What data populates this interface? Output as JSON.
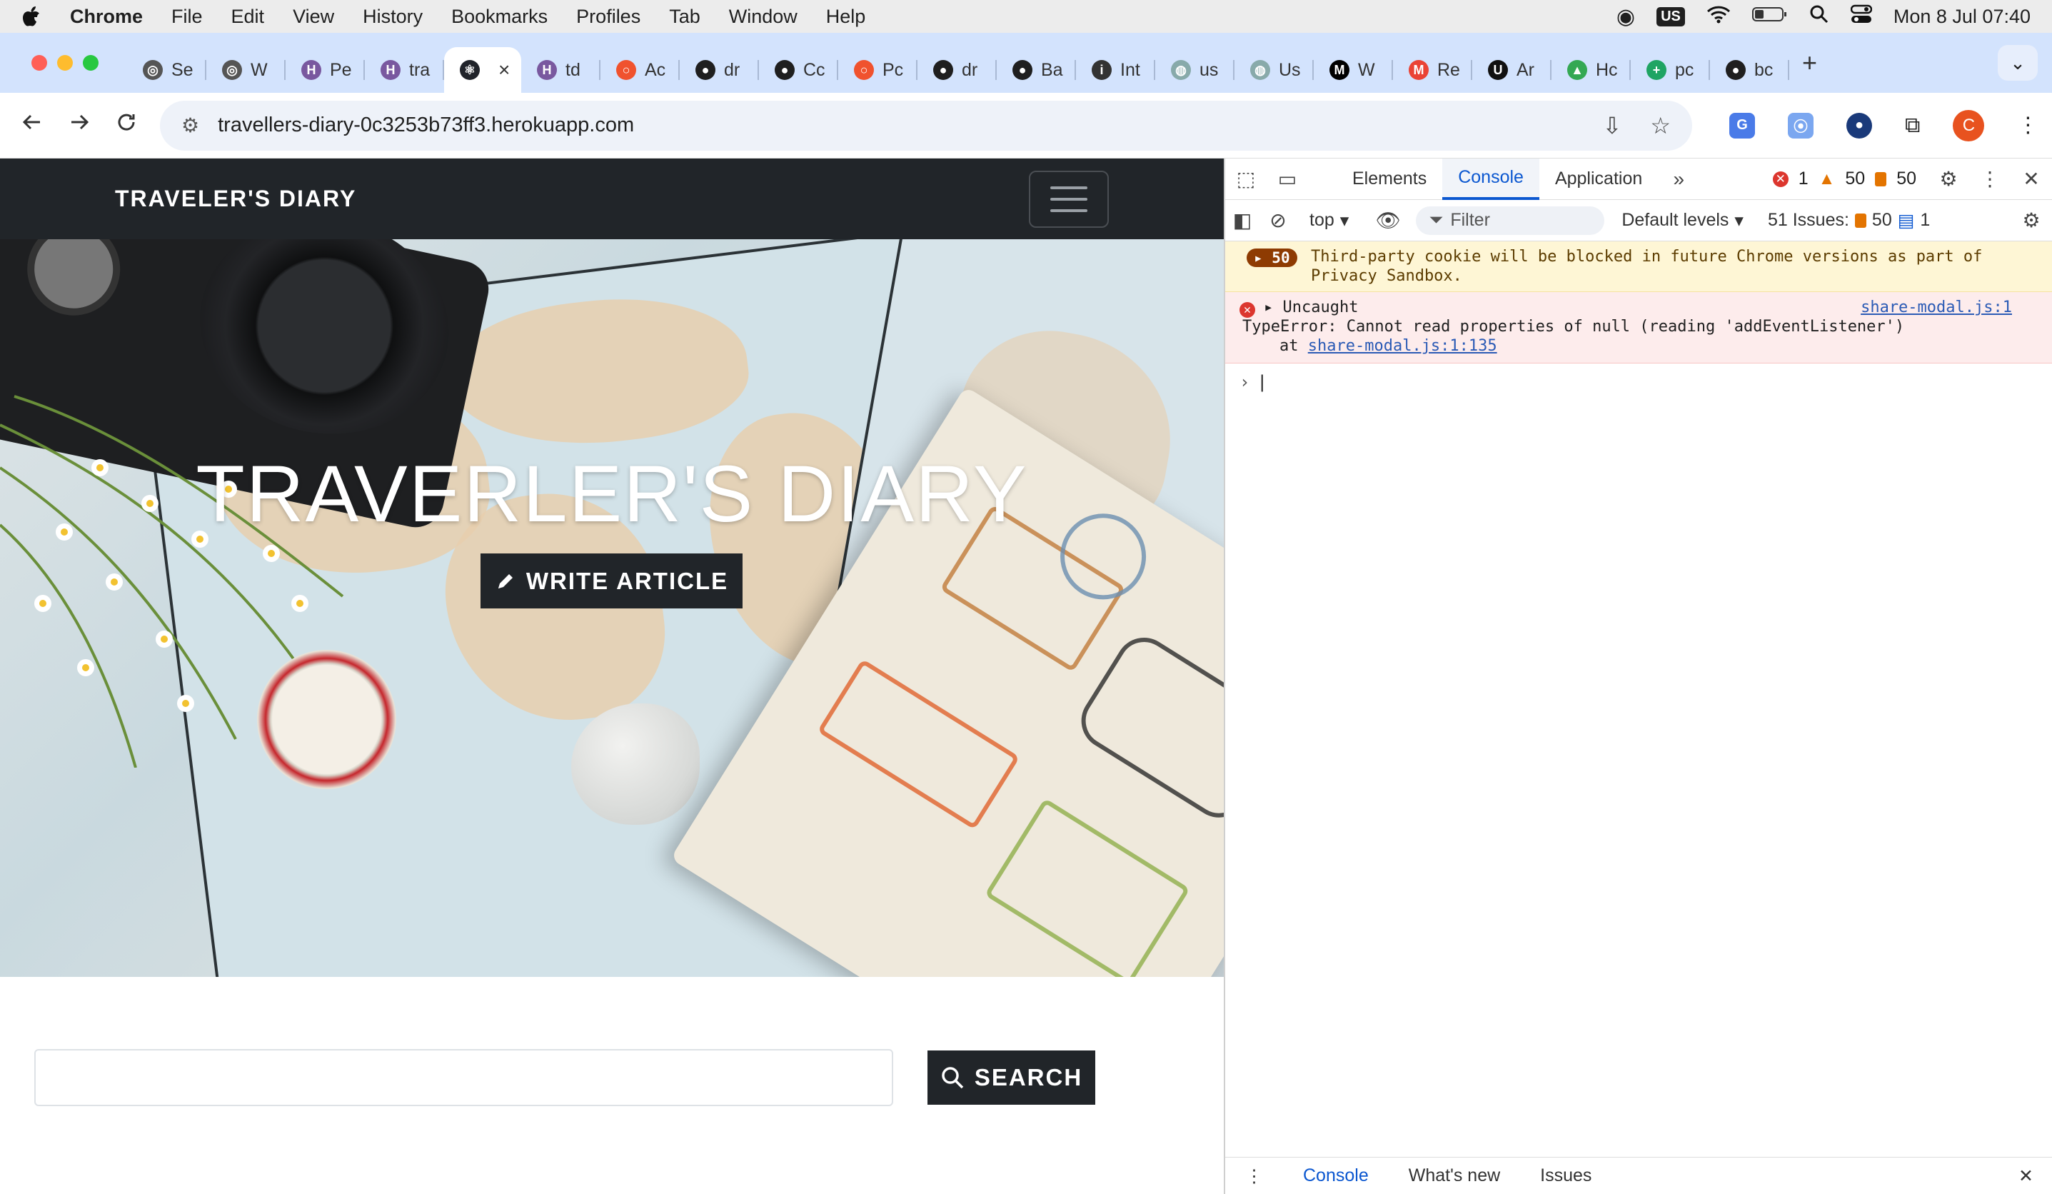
{
  "menubar": {
    "app": "Chrome",
    "items": [
      "File",
      "Edit",
      "View",
      "History",
      "Bookmarks",
      "Profiles",
      "Tab",
      "Window",
      "Help"
    ],
    "keyboard": "US",
    "clock": "Mon 8 Jul  07:40"
  },
  "tabs": [
    {
      "label": "Se",
      "icon": "openai-icon"
    },
    {
      "label": "W",
      "icon": "openai-icon"
    },
    {
      "label": "Pe",
      "icon": "heroku-icon"
    },
    {
      "label": "tra",
      "icon": "heroku-icon"
    },
    {
      "label": "",
      "icon": "react-icon",
      "active": true
    },
    {
      "label": "td",
      "icon": "heroku-icon"
    },
    {
      "label": "Ac",
      "icon": "circle-icon"
    },
    {
      "label": "dr",
      "icon": "github-icon"
    },
    {
      "label": "Cc",
      "icon": "github-icon"
    },
    {
      "label": "Pc",
      "icon": "circle-icon"
    },
    {
      "label": "dr",
      "icon": "github-icon"
    },
    {
      "label": "Ba",
      "icon": "github-icon"
    },
    {
      "label": "Int",
      "icon": "info-icon"
    },
    {
      "label": "us",
      "icon": "globe-icon"
    },
    {
      "label": "Us",
      "icon": "globe-icon"
    },
    {
      "label": "W",
      "icon": "medium-icon"
    },
    {
      "label": "Re",
      "icon": "gmail-icon"
    },
    {
      "label": "Ar",
      "icon": "upwork-icon"
    },
    {
      "label": "Hc",
      "icon": "drive-icon"
    },
    {
      "label": "pc",
      "icon": "sheets-icon"
    },
    {
      "label": "bc",
      "icon": "github-icon"
    }
  ],
  "omnibox": {
    "url": "travellers-diary-0c3253b73ff3.herokuapp.com"
  },
  "profile": {
    "initial": "C"
  },
  "site": {
    "brand": "TRAVELER'S DIARY",
    "hero_title": "TRAVERLER'S DIARY",
    "write_label": "WRITE ARTICLE",
    "search_label": "SEARCH",
    "search_value": ""
  },
  "devtools": {
    "tabs": [
      "Elements",
      "Console",
      "Application"
    ],
    "active_tab": "Console",
    "error_count": "1",
    "warning_count": "50",
    "issue_count": "50",
    "context": "top",
    "filter_placeholder": "Filter",
    "levels": "Default levels",
    "issues_label": "51 Issues:",
    "issues_warn": "50",
    "issues_info": "1",
    "warn_badge": "50",
    "warn_text": "Third-party cookie will be blocked in future Chrome versions as part of Privacy Sandbox.",
    "err_title": "Uncaught",
    "err_source": "share-modal.js:1",
    "err_text": "TypeError: Cannot read properties of null (reading 'addEventListener')",
    "err_at": "at",
    "err_loc": "share-modal.js:1:135",
    "drawer_tabs": [
      "Console",
      "What's new",
      "Issues"
    ]
  },
  "colors": {
    "tabstrip": "#d3e3fd",
    "accent": "#0b57d0",
    "site_dark": "#212529",
    "error": "#dc362e",
    "warning": "#e37400"
  }
}
